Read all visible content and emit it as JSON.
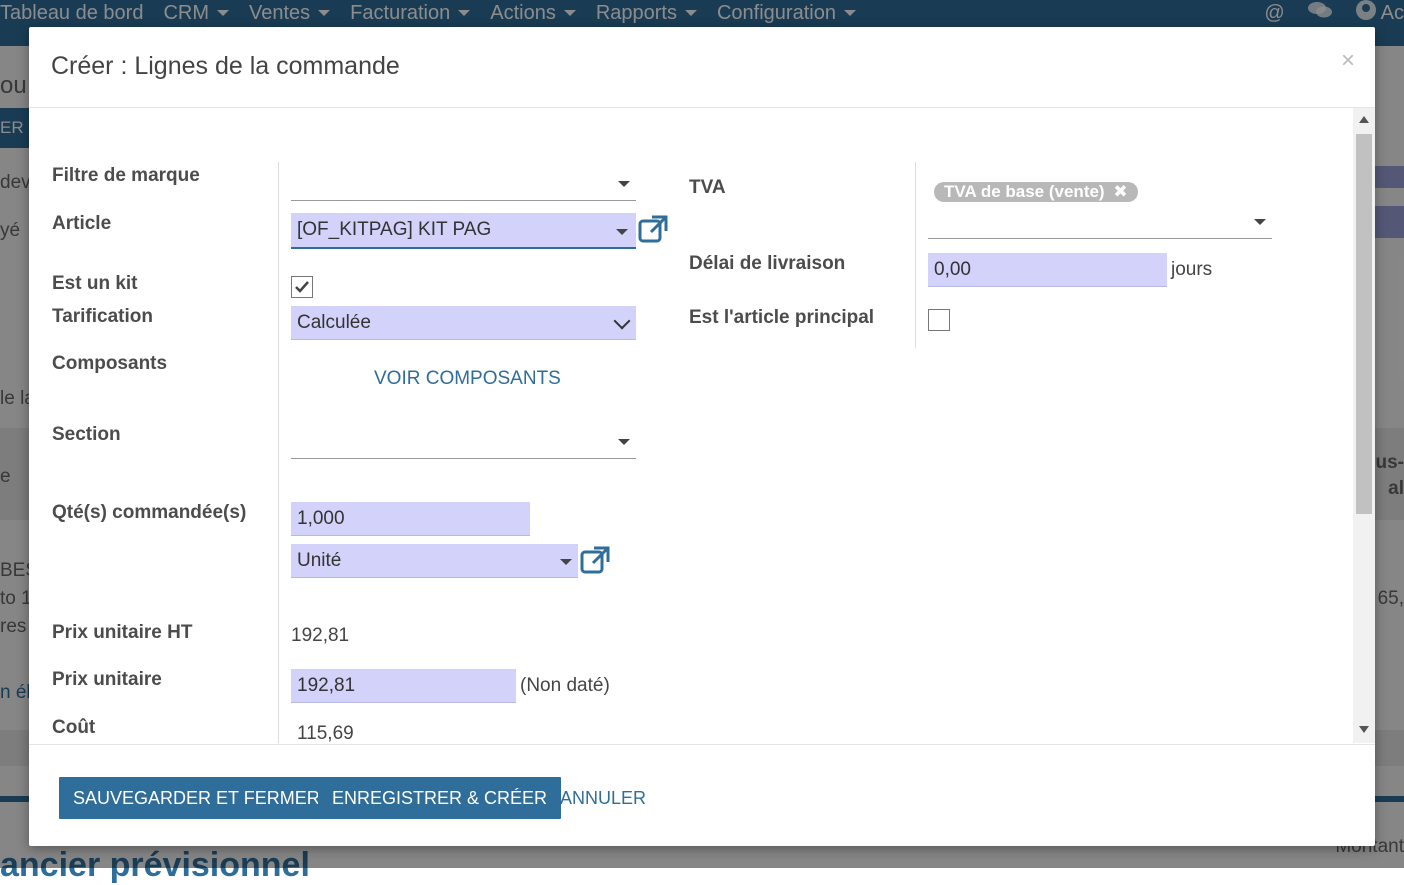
{
  "topbar": {
    "menu": [
      {
        "label": "Tableau de bord",
        "caret": false
      },
      {
        "label": "CRM",
        "caret": true
      },
      {
        "label": "Ventes",
        "caret": true
      },
      {
        "label": "Facturation",
        "caret": true
      },
      {
        "label": "Actions",
        "caret": true
      },
      {
        "label": "Rapports",
        "caret": true
      },
      {
        "label": "Configuration",
        "caret": true
      }
    ],
    "user_label": "Ac"
  },
  "background": {
    "partial_texts": [
      "ou",
      "ER",
      "dev",
      "yé",
      "le la",
      "e",
      "BES",
      "to 1",
      "res",
      "n élé",
      "us-",
      "al",
      "65,",
      "Montant",
      "ancier prévisionnel"
    ]
  },
  "modal": {
    "title": "Créer : Lignes de la commande",
    "close_glyph": "×",
    "left": {
      "brand_filter_label": "Filtre de marque",
      "brand_filter_value": "",
      "article_label": "Article",
      "article_value": "[OF_KITPAG] KIT PAG",
      "is_kit_label": "Est un kit",
      "is_kit_checked": true,
      "pricing_label": "Tarification",
      "pricing_value": "Calculée",
      "components_label": "Composants",
      "components_link": "VOIR COMPOSANTS",
      "section_label": "Section",
      "section_value": "",
      "qty_label": "Qté(s) commandée(s)",
      "qty_value": "1,000",
      "uom_value": "Unité",
      "price_ht_label": "Prix unitaire HT",
      "price_ht_value": "192,81",
      "unit_price_label": "Prix unitaire",
      "unit_price_value": "192,81",
      "unit_price_note": "(Non daté)",
      "cost_label": "Coût",
      "cost_value": "115,69"
    },
    "right": {
      "tva_label": "TVA",
      "tva_tag": "TVA de base (vente)",
      "delivery_label": "Délai de livraison",
      "delivery_value": "0,00",
      "delivery_unit": "jours",
      "main_article_label": "Est l'article principal",
      "main_article_checked": false
    },
    "footer": {
      "save_close": "SAUVEGARDER ET FERMER",
      "save_create": "ENREGISTRER & CRÉER",
      "cancel": "ANNULER"
    }
  },
  "colors": {
    "brand": "#2f6d9a",
    "input_bg": "#d2d2fa",
    "tag_bg": "#b8b8b8"
  }
}
